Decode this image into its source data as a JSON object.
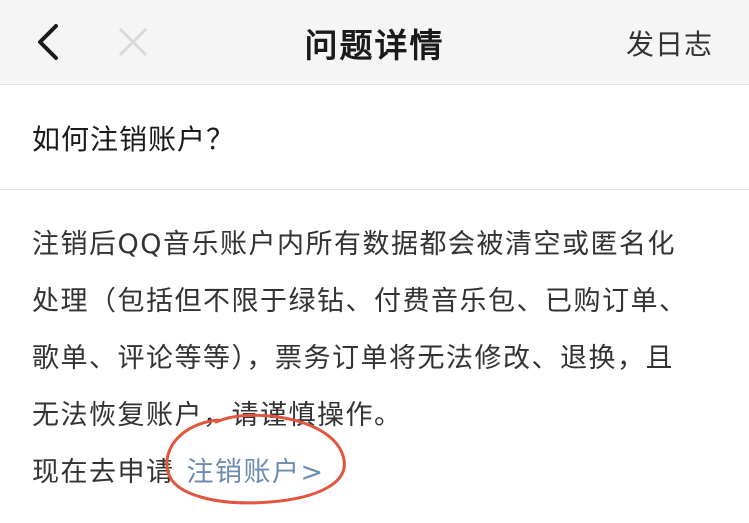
{
  "header": {
    "title": "问题详情",
    "action_label": "发日志"
  },
  "question": {
    "text": "如何注销账户？"
  },
  "answer": {
    "lines": [
      " 注销后QQ音乐账户内所有数据都会被清空或匿名化",
      "处理（包括但不限于绿钻、付费音乐包、已购订单、",
      "歌单、评论等等），票务订单将无法修改、退换，且",
      "无法恢复账户，请谨慎操作。"
    ],
    "apply_prefix": "现在去申请",
    "apply_link": "注销账户>"
  },
  "colors": {
    "link": "#6c8bb0",
    "annotation": "#e0563f",
    "navbar_bg": "#f5f5f5"
  }
}
